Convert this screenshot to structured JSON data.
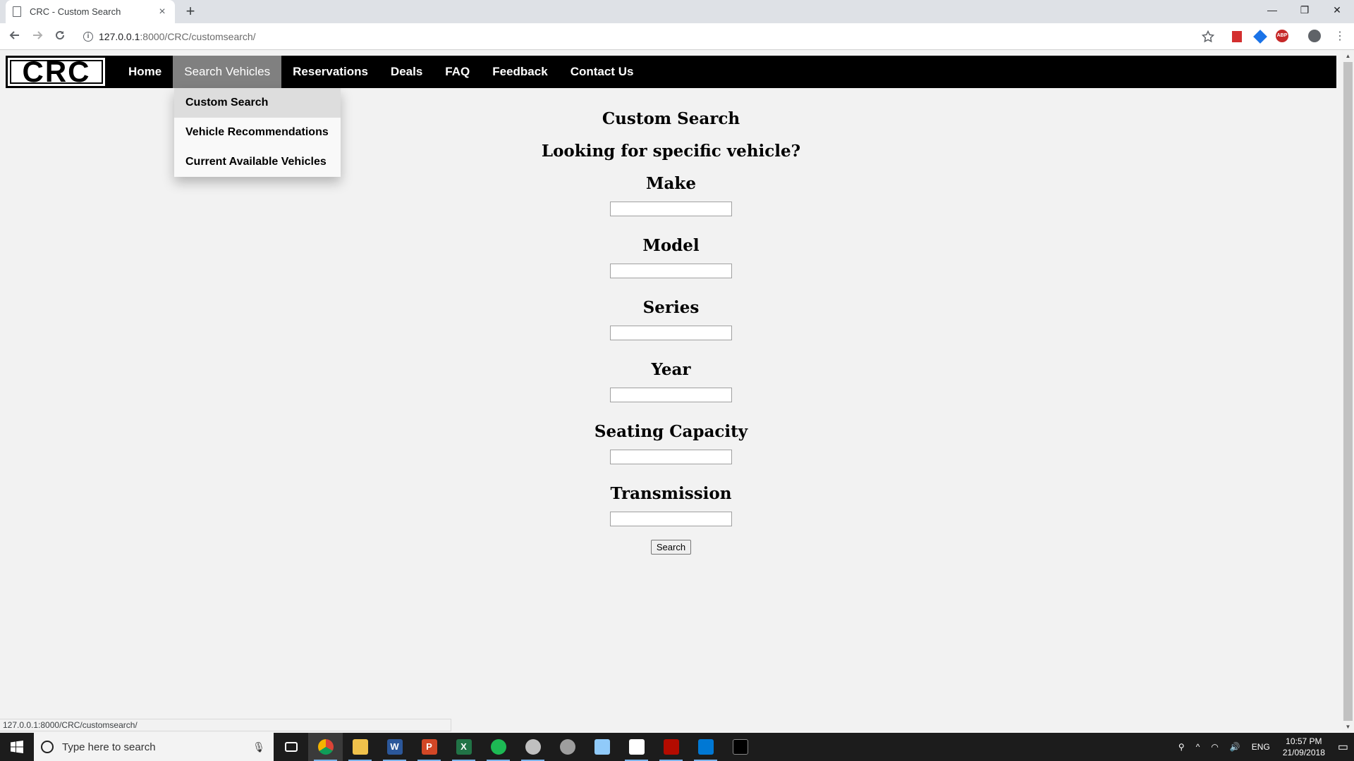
{
  "browser": {
    "tab_title": "CRC - Custom Search",
    "tab_close": "×",
    "new_tab": "+",
    "url_host": "127.0.0.1",
    "url_path": ":8000/CRC/customsearch/",
    "status_url": "127.0.0.1:8000/CRC/customsearch/",
    "minimize": "—",
    "restore": "❐",
    "close": "✕"
  },
  "site": {
    "logo": "CRC",
    "nav": {
      "home": "Home",
      "search_vehicles": "Search Vehicles",
      "reservations": "Reservations",
      "deals": "Deals",
      "faq": "FAQ",
      "feedback": "Feedback",
      "contact": "Contact Us"
    },
    "dropdown": {
      "custom_search": "Custom Search",
      "recommendations": "Vehicle Recommendations",
      "available": "Current Available Vehicles"
    }
  },
  "form": {
    "title": "Custom Search",
    "subtitle": "Looking for specific vehicle?",
    "make_label": "Make",
    "model_label": "Model",
    "series_label": "Series",
    "year_label": "Year",
    "seating_label": "Seating Capacity",
    "transmission_label": "Transmission",
    "make_value": "",
    "model_value": "",
    "series_value": "",
    "year_value": "",
    "seating_value": "",
    "transmission_value": "",
    "search_button": "Search"
  },
  "taskbar": {
    "search_placeholder": "Type here to search",
    "language": "ENG",
    "time": "10:57 PM",
    "date": "21/09/2018",
    "apps": [
      "task-view",
      "chrome",
      "file-explorer",
      "word",
      "powerpoint",
      "excel",
      "spotify",
      "app-bird",
      "paint",
      "notepad",
      "sticky-notes",
      "acrobat",
      "vscode",
      "terminal"
    ]
  },
  "colors": {
    "navbar_bg": "#000000",
    "nav_active_bg": "#808080",
    "dropdown_bg": "#f9f9f9",
    "page_bg": "#f2f2f2"
  }
}
